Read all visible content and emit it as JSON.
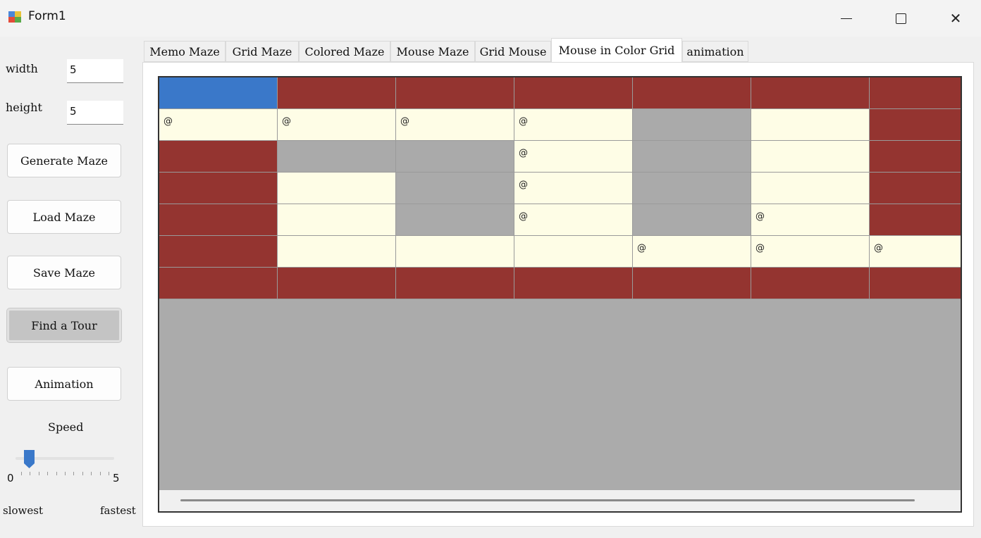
{
  "window": {
    "title": "Form1"
  },
  "left_panel": {
    "width_label": "width",
    "width_value": "5",
    "height_label": "height",
    "height_value": "5",
    "buttons": {
      "generate": "Generate Maze",
      "load": "Load Maze",
      "save": "Save Maze",
      "tour": "Find a Tour",
      "animation": "Animation"
    },
    "speed": {
      "label": "Speed",
      "min_label": "0",
      "max_label": "5",
      "slow_label": "slowest",
      "fast_label": "fastest",
      "value": 0,
      "min": 0,
      "max": 5
    }
  },
  "tabs": [
    {
      "label": "Memo Maze",
      "active": false
    },
    {
      "label": "Grid Maze",
      "active": false
    },
    {
      "label": "Colored Maze",
      "active": false
    },
    {
      "label": "Mouse Maze",
      "active": false
    },
    {
      "label": "Grid Mouse",
      "active": false
    },
    {
      "label": "Mouse in Color Grid",
      "active": true
    },
    {
      "label": "animation",
      "active": false
    }
  ],
  "grid": {
    "legend_colors": {
      "W": "#943430",
      "O": "#fefde6",
      "G": "#aaaaaa",
      "S": "#3a78c9"
    },
    "mark": "@",
    "rows": [
      [
        "S",
        "W",
        "W",
        "W",
        "W",
        "W",
        "W"
      ],
      [
        "O@",
        "O@",
        "O@",
        "O@",
        "G",
        "O",
        "W"
      ],
      [
        "W",
        "G",
        "G",
        "O@",
        "G",
        "O",
        "W"
      ],
      [
        "W",
        "O",
        "G",
        "O@",
        "G",
        "O",
        "W"
      ],
      [
        "W",
        "O",
        "G",
        "O@",
        "G",
        "O@",
        "W"
      ],
      [
        "W",
        "O",
        "O",
        "O",
        "O@",
        "O@",
        "O@"
      ],
      [
        "W",
        "W",
        "W",
        "W",
        "W",
        "W",
        "W"
      ]
    ]
  }
}
